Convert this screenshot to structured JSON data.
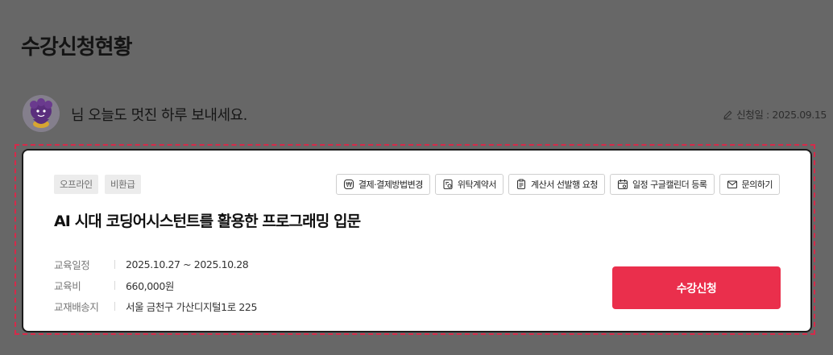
{
  "page": {
    "title": "수강신청현황"
  },
  "greeting": {
    "message": "님 오늘도 멋진 하루 보내세요.",
    "apply_date": "신청일 : 2025.09.15"
  },
  "course": {
    "tags": [
      "오프라인",
      "비환급"
    ],
    "actions": [
      {
        "label": "결제·결제방법변경",
        "icon": "payment-icon"
      },
      {
        "label": "위탁계약서",
        "icon": "contract-icon"
      },
      {
        "label": "계산서 선발행 요청",
        "icon": "invoice-icon"
      },
      {
        "label": "일정 구글캘린더 등록",
        "icon": "calendar-icon"
      },
      {
        "label": "문의하기",
        "icon": "mail-icon"
      }
    ],
    "title": "AI 시대 코딩어시스턴트를 활용한 프로그래밍 입문",
    "info": {
      "schedule_label": "교육일정",
      "schedule_value": "2025.10.27 ~ 2025.10.28",
      "fee_label": "교육비",
      "fee_value": "660,000원",
      "address_label": "교재배송지",
      "address_value": "서울 금천구 가산디지털1로 225"
    },
    "enroll_label": "수강신청"
  },
  "colors": {
    "accent": "#ea2f4c",
    "overlay": "#676767",
    "focus_border": "#d62a4a"
  }
}
